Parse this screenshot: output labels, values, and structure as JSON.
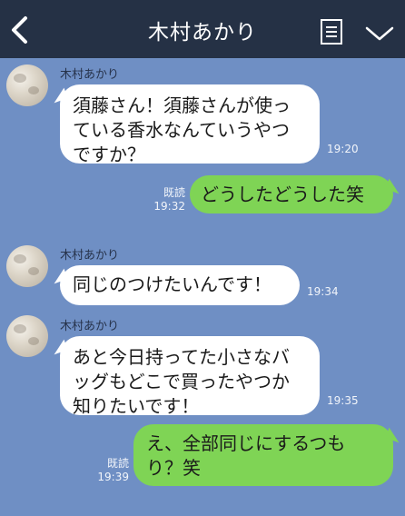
{
  "header": {
    "title": "木村あかり",
    "icons": [
      "back-arrow",
      "memo",
      "chevron-down"
    ]
  },
  "messages": [
    {
      "sender": "木村あかり",
      "text": "須藤さん！須藤さんが使っている香水なんていうやつですか？",
      "time": "19:20"
    },
    {
      "read": "既読",
      "text": "どうしたどうした笑",
      "time": "19:32"
    },
    {
      "sender": "木村あかり",
      "text": "同じのつけたいんです！",
      "time": "19:34"
    },
    {
      "sender": "木村あかり",
      "text": "あと今日持ってた小さなバッグもどこで買ったやつか知りたいです！",
      "time": "19:35"
    },
    {
      "read": "既読",
      "text": "え、全部同じにするつもり？笑",
      "time": "19:39"
    }
  ],
  "colors": {
    "background": "#6f8fc4",
    "header": "#253145",
    "sent_bubble": "#7fd455",
    "received_bubble": "#ffffff"
  }
}
